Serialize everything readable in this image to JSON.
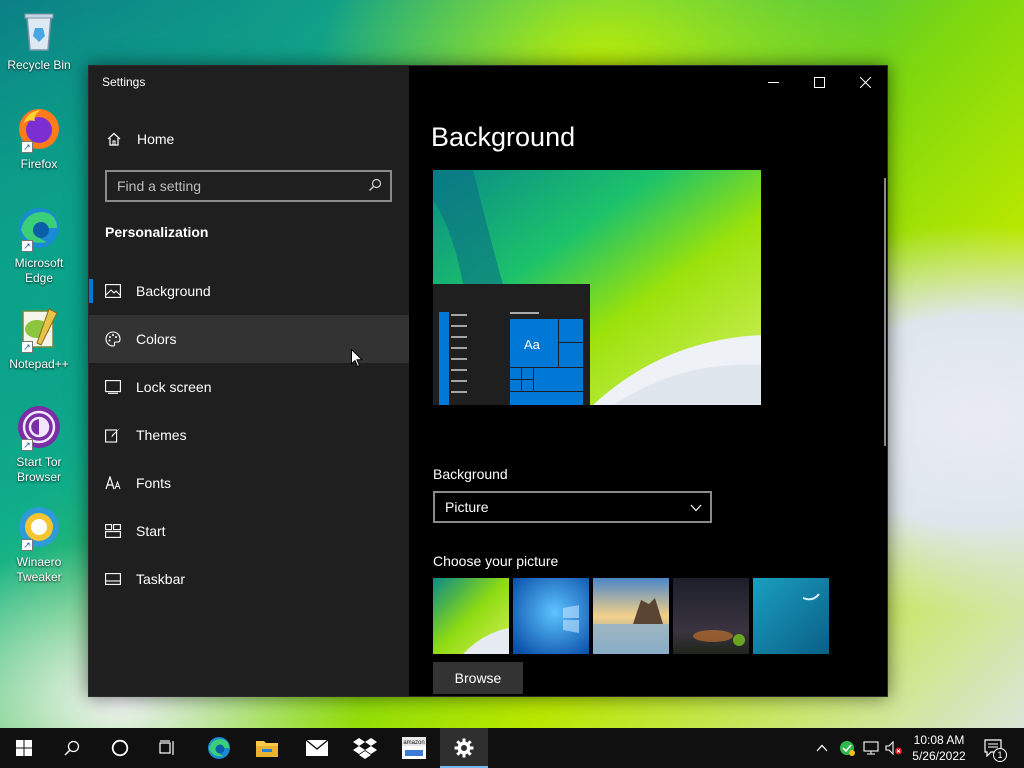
{
  "desktop": {
    "icons": [
      {
        "label": "Recycle Bin"
      },
      {
        "label": "Firefox"
      },
      {
        "label": "Microsoft Edge"
      },
      {
        "label": "Notepad++"
      },
      {
        "label": "Start Tor Browser"
      },
      {
        "label": "Winaero Tweaker"
      }
    ]
  },
  "window": {
    "title": "Settings",
    "home_label": "Home",
    "search_placeholder": "Find a setting",
    "section_title": "Personalization",
    "nav": [
      {
        "label": "Background",
        "icon": "picture-icon",
        "selected": true
      },
      {
        "label": "Colors",
        "icon": "palette-icon",
        "hovered": true
      },
      {
        "label": "Lock screen",
        "icon": "lock-screen-icon"
      },
      {
        "label": "Themes",
        "icon": "brush-icon"
      },
      {
        "label": "Fonts",
        "icon": "fonts-icon"
      },
      {
        "label": "Start",
        "icon": "start-icon"
      },
      {
        "label": "Taskbar",
        "icon": "taskbar-icon"
      }
    ],
    "content": {
      "page_title": "Background",
      "preview_tile_text": "Aa",
      "background_label": "Background",
      "background_value": "Picture",
      "choose_picture_label": "Choose your picture",
      "browse_label": "Browse"
    }
  },
  "taskbar": {
    "time": "10:08 AM",
    "date": "5/26/2022",
    "notification_count": "1",
    "accent": "#76b9ed"
  },
  "colors": {
    "accent": "#0078d7",
    "sidebar_bg": "#1f1f1f",
    "content_bg": "#000000"
  }
}
